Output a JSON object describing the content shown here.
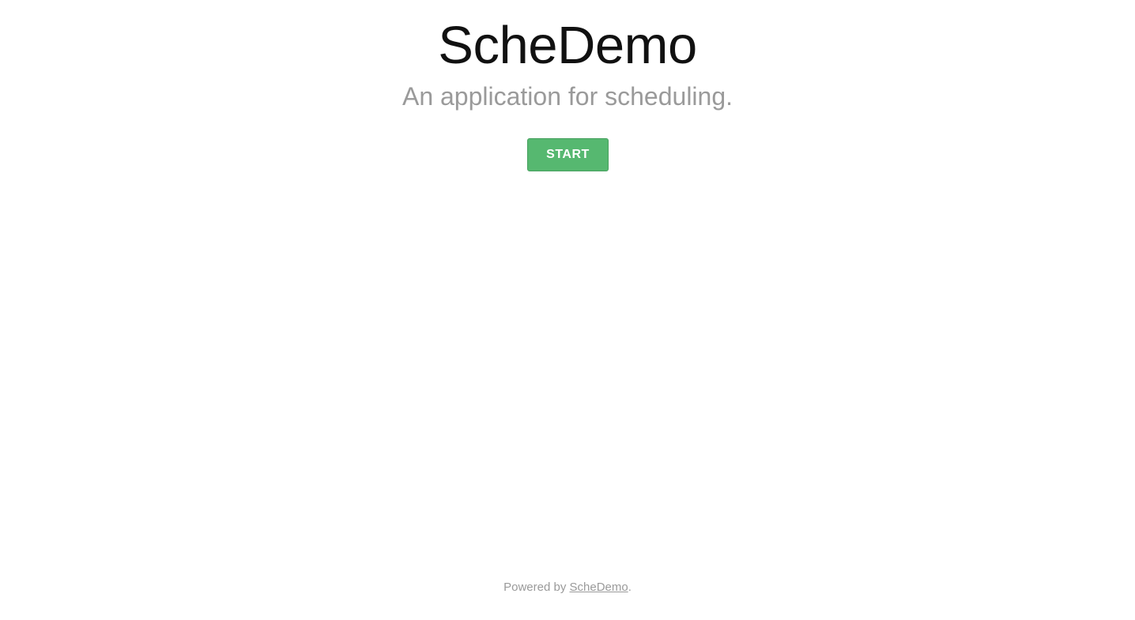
{
  "hero": {
    "title": "ScheDemo",
    "subtitle": "An application for scheduling."
  },
  "actions": {
    "start_label": "START"
  },
  "footer": {
    "prefix": "Powered by ",
    "link_text": "ScheDemo",
    "suffix": "."
  },
  "colors": {
    "accent_button": "#56b870",
    "title_text": "#111111",
    "muted_text": "#9a9a9a",
    "background": "#ffffff"
  }
}
